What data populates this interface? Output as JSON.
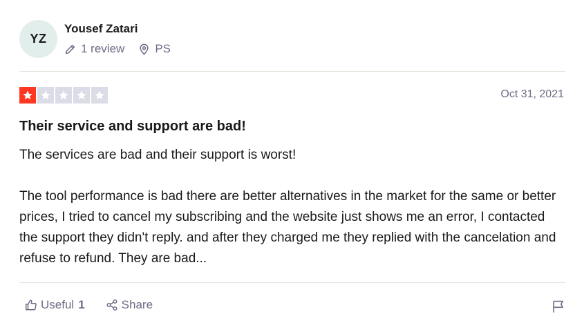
{
  "user": {
    "initials": "YZ",
    "name": "Yousef Zatari",
    "review_count": "1 review",
    "country": "PS"
  },
  "review": {
    "rating": 1,
    "max_rating": 5,
    "date": "Oct 31, 2021",
    "title": "Their service and support are bad!",
    "paragraphs": [
      "The services are bad and their support is worst!",
      "The tool performance is bad there are better alternatives in the market for the same or better prices, I tried to cancel my subscribing and the website just shows me an error, I contacted the support they didn't reply. and after they charged me they replied with the cancelation and refuse to refund. They are bad..."
    ]
  },
  "actions": {
    "useful_label": "Useful",
    "useful_count": "1",
    "share_label": "Share"
  },
  "colors": {
    "star_filled": "#ff3722",
    "star_empty": "#dcdce6",
    "avatar_bg": "#e1eeec",
    "muted_text": "#6c6c85"
  },
  "icons": {
    "review_count": "pencil-icon",
    "location": "location-pin-icon",
    "useful": "thumbs-up-icon",
    "share": "share-icon",
    "report": "flag-icon",
    "star": "star-icon"
  }
}
